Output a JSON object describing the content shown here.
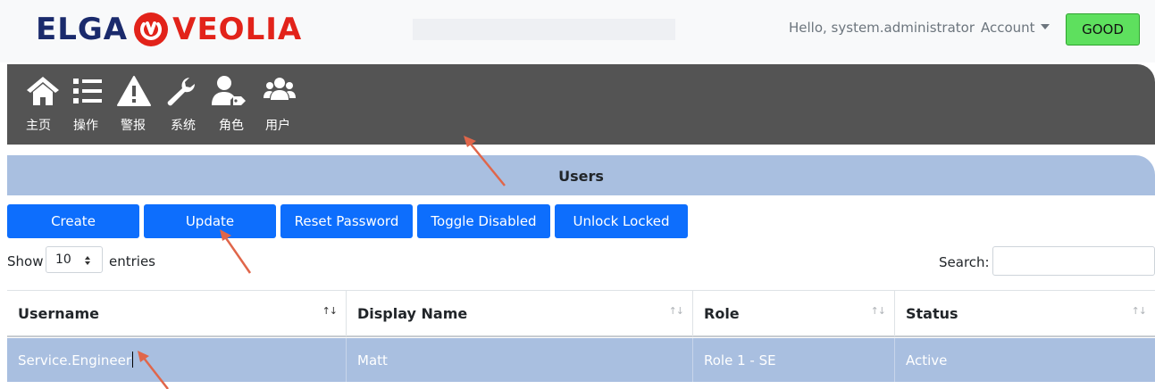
{
  "header": {
    "logo_left": "ELGA",
    "logo_right": "VEOLIA",
    "greeting": "Hello, system.administrator",
    "account_label": "Account",
    "status_badge": "GOOD",
    "colors": {
      "elga": "#1a2a6c",
      "veolia": "#e2231a",
      "status": "#5ee05e"
    }
  },
  "nav": {
    "items": [
      {
        "icon": "home-icon",
        "label": "主页"
      },
      {
        "icon": "list-icon",
        "label": "操作"
      },
      {
        "icon": "warning-icon",
        "label": "警报"
      },
      {
        "icon": "wrench-icon",
        "label": "系统"
      },
      {
        "icon": "user-tag-icon",
        "label": "角色"
      },
      {
        "icon": "users-icon",
        "label": "用户"
      }
    ]
  },
  "page": {
    "title": "Users"
  },
  "actions": {
    "create": "Create",
    "update": "Update",
    "reset_password": "Reset Password",
    "toggle_disabled": "Toggle Disabled",
    "unlock_locked": "Unlock Locked",
    "color": "#0d6efd"
  },
  "length": {
    "show": "Show",
    "value": "10",
    "entries": "entries"
  },
  "search": {
    "label": "Search:",
    "value": ""
  },
  "table": {
    "columns": [
      "Username",
      "Display Name",
      "Role",
      "Status"
    ],
    "rows": [
      {
        "username": "Service.Engineer",
        "display_name": "Matt",
        "role": "Role 1 - SE",
        "status": "Active"
      }
    ],
    "selected_color": "#a9bfe0"
  }
}
